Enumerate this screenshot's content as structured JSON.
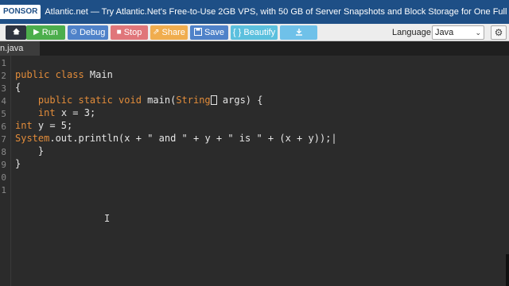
{
  "banner": {
    "tag": "PONSOR",
    "text": "Atlantic.net — Try Atlantic.Net's Free-to-Use 2GB VPS, with 50 GB of Server Snapshots and Block Storage for One Full Year."
  },
  "toolbar": {
    "run": "Run",
    "debug": "Debug",
    "stop": "Stop",
    "share": "Share",
    "save": "Save",
    "beautify": "{ } Beautify",
    "language_label": "Language",
    "language_value": "Java"
  },
  "tab": {
    "label": "n.java"
  },
  "editor": {
    "line_numbers": [
      "1",
      "2",
      "3",
      "4",
      "5",
      "6",
      "7",
      "8",
      "9",
      "0",
      "1"
    ]
  },
  "colors": {
    "banner": "#1e4f86",
    "run": "#4cae4c",
    "stop": "#e0767a",
    "share": "#f0ad4e",
    "keyword": "#e28c3a"
  },
  "icons": [
    "menu-home-icon",
    "play-icon",
    "debug-icon",
    "stop-icon",
    "share-icon",
    "save-icon",
    "download-icon",
    "gear-icon",
    "chevron-down-icon"
  ]
}
